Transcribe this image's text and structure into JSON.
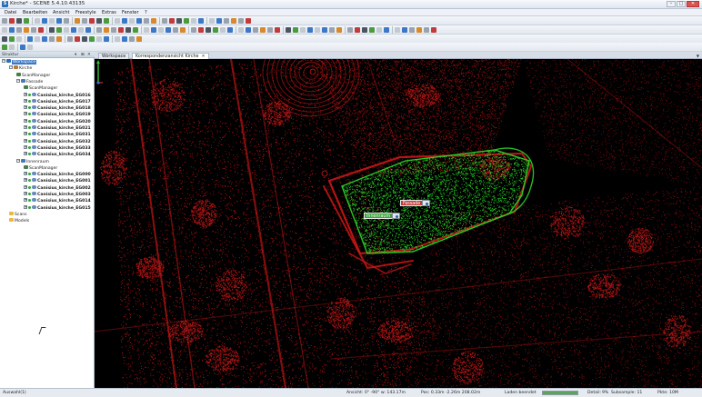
{
  "window": {
    "title": "Kirche* - SCENE 5.4.10.43135",
    "icon": "scene-app-icon"
  },
  "menu": [
    "Datei",
    "Bearbeiten",
    "Ansicht",
    "Freestyle",
    "Extras",
    "Fenster",
    "?"
  ],
  "left_panel": {
    "title": "Struktur",
    "tree": [
      {
        "label": "Workspace",
        "level": 0,
        "icon": "workspace-icon",
        "selected": true,
        "bold": false
      },
      {
        "label": "Kirche",
        "level": 1,
        "icon": "house-icon",
        "bold": false
      },
      {
        "label": "ScanManager",
        "level": 2,
        "icon": "scanmanager-icon",
        "bold": false
      },
      {
        "label": "Fassade",
        "level": 2,
        "icon": "cluster-icon",
        "bold": false
      },
      {
        "label": "ScanManager",
        "level": 3,
        "icon": "scanmanager-icon",
        "bold": false
      },
      {
        "label": "Canisius_kirche_EG016",
        "level": 3,
        "icon": "scan-icon",
        "bold": true
      },
      {
        "label": "Canisius_kirche_EG017",
        "level": 3,
        "icon": "scan-icon",
        "bold": true
      },
      {
        "label": "Canisius_kirche_EG018",
        "level": 3,
        "icon": "scan-icon",
        "bold": true
      },
      {
        "label": "Canisius_kirche_EG019",
        "level": 3,
        "icon": "scan-icon",
        "bold": true
      },
      {
        "label": "Canisius_kirche_EG020",
        "level": 3,
        "icon": "scan-icon",
        "bold": true
      },
      {
        "label": "Canisius_kirche_EG021",
        "level": 3,
        "icon": "scan-icon",
        "bold": true
      },
      {
        "label": "Canisius_kirche_EG031",
        "level": 3,
        "icon": "scan-icon",
        "bold": true
      },
      {
        "label": "Canisius_kirche_EG032",
        "level": 3,
        "icon": "scan-icon",
        "bold": true
      },
      {
        "label": "Canisius_kirche_EG033",
        "level": 3,
        "icon": "scan-icon",
        "bold": true
      },
      {
        "label": "Canisius_kirche_EG034",
        "level": 3,
        "icon": "scan-icon",
        "bold": true
      },
      {
        "label": "Innenraum",
        "level": 2,
        "icon": "cluster-icon",
        "bold": false
      },
      {
        "label": "ScanManager",
        "level": 3,
        "icon": "scanmanager-icon",
        "bold": false
      },
      {
        "label": "Canisius_kirche_EG000",
        "level": 3,
        "icon": "scan-icon",
        "bold": true
      },
      {
        "label": "Canisius_kirche_EG001",
        "level": 3,
        "icon": "scan-icon",
        "bold": true
      },
      {
        "label": "Canisius_kirche_EG002",
        "level": 3,
        "icon": "scan-icon",
        "bold": true
      },
      {
        "label": "Canisius_kirche_EG003",
        "level": 3,
        "icon": "scan-icon",
        "bold": true
      },
      {
        "label": "Canisius_kirche_EG014",
        "level": 3,
        "icon": "scan-icon",
        "bold": true
      },
      {
        "label": "Canisius_kirche_EG015",
        "level": 3,
        "icon": "scan-icon",
        "bold": true
      },
      {
        "label": "Scans",
        "level": 1,
        "icon": "folder-icon",
        "bold": false
      },
      {
        "label": "Models",
        "level": 1,
        "icon": "folder-icon",
        "bold": false
      }
    ]
  },
  "tabs": [
    {
      "label": "Workspace",
      "active": false
    },
    {
      "label": "Korrespondenzansicht Kirche",
      "active": true
    }
  ],
  "viewport": {
    "labels": {
      "fassade": "Fassade",
      "innenraum": "Innenraum"
    },
    "colors": {
      "background": "#000000",
      "fassade_points": "#d41818",
      "innenraum_points": "#28d228"
    }
  },
  "status": {
    "left": "Auswahl(1)",
    "view": "Ansicht: 0° -90° w: 143.17m",
    "pos": "Pos: 0.33m -2.26m 208.02m",
    "load": "Laden beendet",
    "detail": "Detail:",
    "detail_value": "9%",
    "subsample": "Subsample: 11",
    "points": "Pkte: 10M",
    "progress": 1.0
  }
}
